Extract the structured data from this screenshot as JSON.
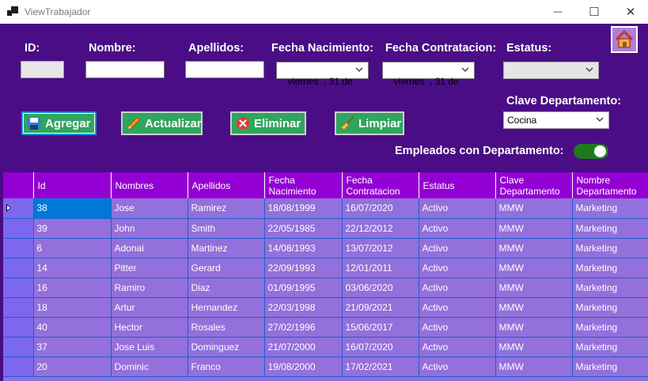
{
  "window": {
    "title": "ViewTrabajador",
    "minimize_glyph": "—",
    "maximize_glyph": "☐",
    "close_glyph": "✕"
  },
  "form": {
    "id_label": "ID:",
    "id_value": "",
    "nombre_label": "Nombre:",
    "nombre_value": "",
    "apellidos_label": "Apellidos:",
    "apellidos_value": "",
    "fecha_nacimiento_label": "Fecha Nacimiento:",
    "fecha_nacimiento_value": "viernes  , 31 de",
    "fecha_contratacion_label": "Fecha Contratacion:",
    "fecha_contratacion_value": "viernes  , 31 de",
    "estatus_label": "Estatus:",
    "estatus_value": "",
    "clave_departamento_label": "Clave Departamento:",
    "clave_departamento_value": "Cocina",
    "toggle_label": "Empleados con Departamento:",
    "toggle_on": true
  },
  "buttons": {
    "agregar": "Agregar",
    "actualizar": "Actualizar",
    "eliminar": "Eliminar",
    "limpiar": "Limpiar"
  },
  "icons": {
    "home": "home-icon",
    "agregar": "floppy-disk-icon",
    "actualizar": "pencil-icon",
    "eliminar": "delete-x-icon",
    "limpiar": "broom-icon"
  },
  "colors": {
    "background": "#4a0d86",
    "button": "#2fa55f",
    "grid_header": "#9400d3",
    "grid_row": "#9370db",
    "selection": "#0078d7",
    "toggle_on": "#1f7a1f"
  },
  "grid": {
    "columns": [
      "Id",
      "Nombres",
      "Apellidos",
      "Fecha Nacimiento",
      "Fecha Contratacion",
      "Estatus",
      "Clave Departamento",
      "Nombre Departamento"
    ],
    "rows": [
      [
        "38",
        "Jose",
        "Ramirez",
        "18/08/1999",
        "16/07/2020",
        "Activo",
        "MMW",
        "Marketing"
      ],
      [
        "39",
        "John",
        "Smith",
        "22/05/1985",
        "22/12/2012",
        "Activo",
        "MMW",
        "Marketing"
      ],
      [
        "6",
        "Adonai",
        "Martinez",
        "14/08/1993",
        "13/07/2012",
        "Activo",
        "MMW",
        "Marketing"
      ],
      [
        "14",
        "Pitter",
        "Gerard",
        "22/09/1993",
        "12/01/2011",
        "Activo",
        "MMW",
        "Marketing"
      ],
      [
        "16",
        "Ramiro",
        "Diaz",
        "01/09/1995",
        "03/06/2020",
        "Activo",
        "MMW",
        "Marketing"
      ],
      [
        "18",
        "Artur",
        "Hernandez",
        "22/03/1998",
        "21/09/2021",
        "Activo",
        "MMW",
        "Marketing"
      ],
      [
        "40",
        "Hector",
        "Rosales",
        "27/02/1996",
        "15/06/2017",
        "Activo",
        "MMW",
        "Marketing"
      ],
      [
        "37",
        "Jose Luis",
        "Dominguez",
        "21/07/2000",
        "16/07/2020",
        "Activo",
        "MMW",
        "Marketing"
      ],
      [
        "20",
        "Dominic",
        "Franco",
        "19/08/2000",
        "17/02/2021",
        "Activo",
        "MMW",
        "Marketing"
      ]
    ],
    "selected_row": 0
  }
}
